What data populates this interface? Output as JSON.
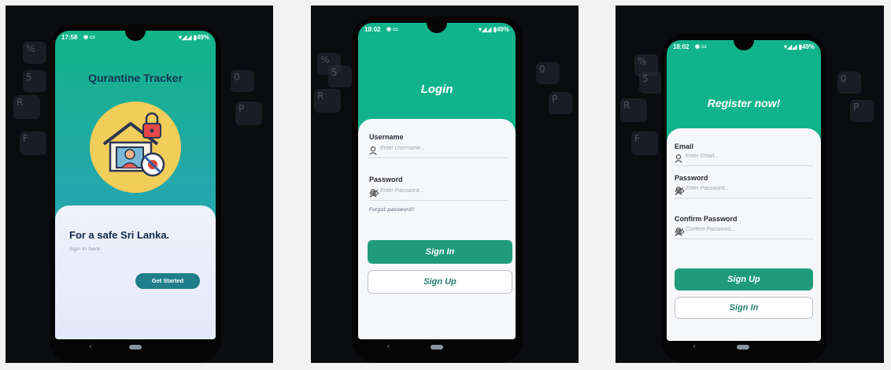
{
  "screens": [
    {
      "status_time": "17:58",
      "status_right": "▾◢◢ ▮49%",
      "title": "Qurantine Tracker",
      "tagline": "For a safe Sri Lanka.",
      "subtext": "Sign in here",
      "button": "Get Started",
      "illustration_icons": [
        "house-icon",
        "padlock-icon",
        "person-icon",
        "no-virus-icon"
      ]
    },
    {
      "status_time": "18:02",
      "status_right": "▾◢◢ ▮49%",
      "title": "Login",
      "fields": [
        {
          "label": "Username",
          "placeholder": "Enter Username...",
          "eye": false
        },
        {
          "label": "Password",
          "placeholder": "Enter Password...",
          "eye": true
        }
      ],
      "forgot": "Forgot password?",
      "primary_button": "Sign In",
      "secondary_button": "Sign Up"
    },
    {
      "status_time": "18:02",
      "status_right": "▾◢◢ ▮49%",
      "title": "Register now!",
      "fields": [
        {
          "label": "Email",
          "placeholder": "Enter Email...",
          "eye": false
        },
        {
          "label": "Password",
          "placeholder": "Enter Password...",
          "eye": true
        },
        {
          "label": "Confirm Password",
          "placeholder": "Confirm Password...",
          "eye": true
        }
      ],
      "primary_button": "Sign Up",
      "secondary_button": "Sign In"
    }
  ],
  "nav": {
    "back_glyph": "‹"
  },
  "colors": {
    "teal_top": "#0fb38c",
    "teal_button": "#1f9b7a",
    "splash_gradient_top": "#12b488",
    "splash_gradient_bottom": "#2da0b8",
    "card": "#f6f7f9",
    "illustration_circle": "#f1cd5a"
  }
}
